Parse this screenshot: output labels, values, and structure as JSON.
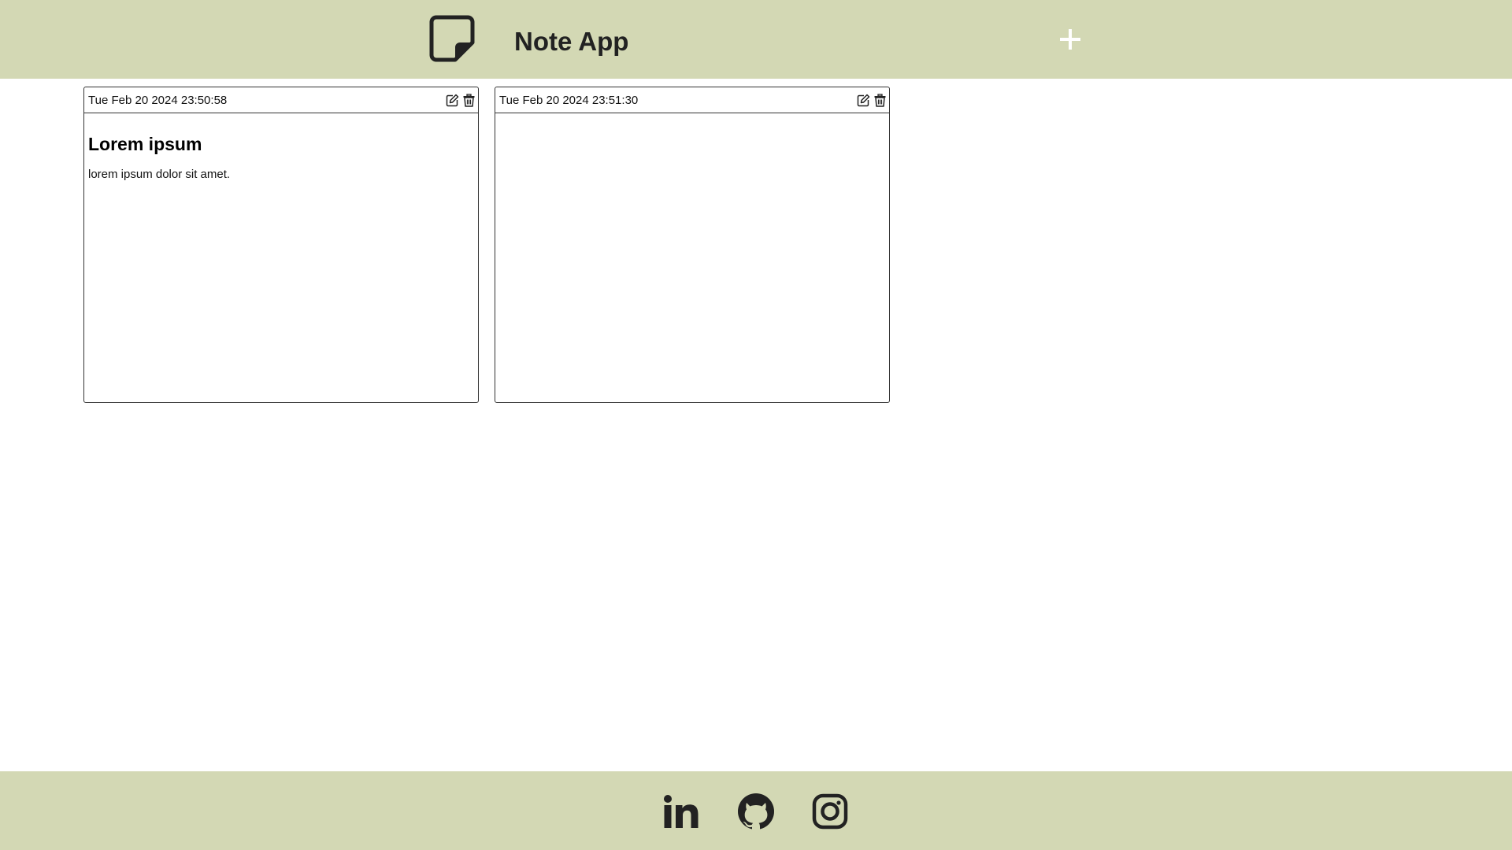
{
  "header": {
    "title": "Note App",
    "logo_icon": "sticky-note-icon",
    "add_icon": "plus-icon"
  },
  "notes": [
    {
      "date": "Tue Feb 20 2024 23:50:58",
      "title": "Lorem ipsum",
      "text": "lorem ipsum dolor sit amet.",
      "edit_icon": "edit-icon",
      "delete_icon": "trash-icon"
    },
    {
      "date": "Tue Feb 20 2024 23:51:30",
      "title": "",
      "text": "",
      "edit_icon": "edit-icon",
      "delete_icon": "trash-icon"
    }
  ],
  "footer": {
    "social_icons": [
      "linkedin-icon",
      "github-icon",
      "instagram-icon"
    ]
  },
  "colors": {
    "bar_background": "#d3d8b4",
    "icon_dark": "#222222",
    "add_icon": "#ffffff"
  }
}
